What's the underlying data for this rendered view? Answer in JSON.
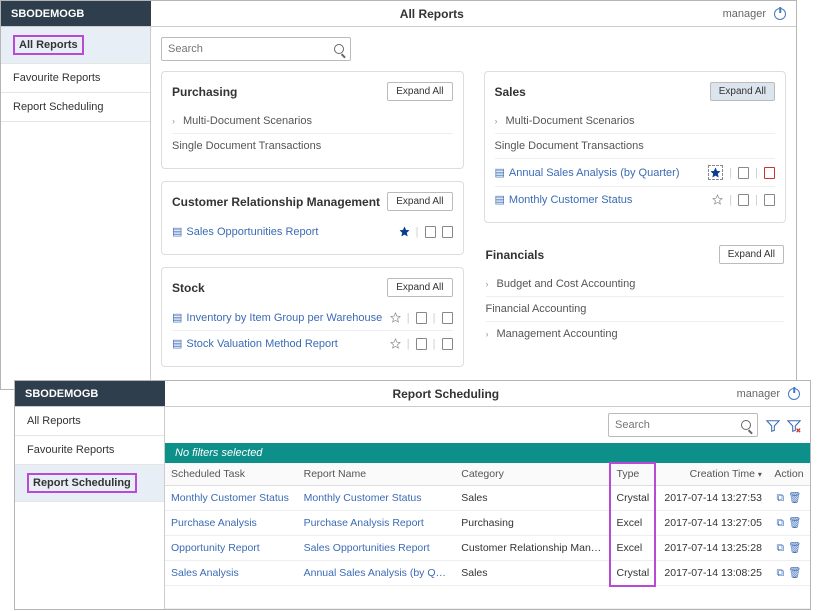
{
  "window1": {
    "brand": "SBODEMOGB",
    "title": "All Reports",
    "user": "manager",
    "sidebar": {
      "items": [
        {
          "label": "All Reports",
          "active": true,
          "highlighted": true
        },
        {
          "label": "Favourite Reports"
        },
        {
          "label": "Report Scheduling"
        }
      ]
    },
    "search": {
      "placeholder": "Search"
    },
    "left_col": [
      {
        "title": "Purchasing",
        "expand": "Expand All",
        "items": [
          {
            "label": "Multi-Document Scenarios",
            "chevron": true
          },
          {
            "label": "Single Document Transactions"
          }
        ]
      },
      {
        "title": "Customer Relationship Management",
        "expand": "Expand All",
        "items": [
          {
            "label": "Sales Opportunities Report",
            "doc": true,
            "star_filled": true,
            "actions": true
          }
        ]
      },
      {
        "title": "Stock",
        "expand": "Expand All",
        "items": [
          {
            "label": "Inventory by Item Group per Warehouse",
            "doc": true,
            "star": true,
            "actions": true
          },
          {
            "label": "Stock Valuation Method Report",
            "doc": true,
            "star": true,
            "actions": true
          }
        ]
      }
    ],
    "right_col": [
      {
        "title": "Sales",
        "expand": "Expand All",
        "expand_selected": true,
        "items": [
          {
            "label": "Multi-Document Scenarios",
            "chevron": true
          },
          {
            "label": "Single Document Transactions"
          },
          {
            "label": "Annual Sales Analysis (by Quarter)",
            "doc": true,
            "star_box_filled": true,
            "actions": true,
            "red_clip": true
          },
          {
            "label": "Monthly Customer Status",
            "doc": true,
            "star": true,
            "actions": true
          }
        ]
      },
      {
        "title": "Financials",
        "expand": "Expand All",
        "plain": true,
        "items": [
          {
            "label": "Budget and Cost Accounting",
            "chevron": true
          },
          {
            "label": "Financial Accounting"
          },
          {
            "label": "Management Accounting",
            "chevron": true
          }
        ]
      }
    ]
  },
  "window2": {
    "brand": "SBODEMOGB",
    "title": "Report Scheduling",
    "user": "manager",
    "sidebar": {
      "items": [
        {
          "label": "All Reports"
        },
        {
          "label": "Favourite Reports"
        },
        {
          "label": "Report Scheduling",
          "active": true,
          "highlighted": true
        }
      ]
    },
    "search": {
      "placeholder": "Search"
    },
    "filterbar": "No filters selected",
    "columns": {
      "task": "Scheduled Task",
      "report": "Report Name",
      "category": "Category",
      "type": "Type",
      "created": "Creation Time",
      "action": "Action"
    },
    "rows": [
      {
        "task": "Monthly Customer Status",
        "report": "Monthly Customer Status",
        "category": "Sales",
        "type": "Crystal",
        "created": "2017-07-14 13:27:53"
      },
      {
        "task": "Purchase Analysis",
        "report": "Purchase Analysis Report",
        "category": "Purchasing",
        "type": "Excel",
        "created": "2017-07-14 13:27:05"
      },
      {
        "task": "Opportunity Report",
        "report": "Sales Opportunities Report",
        "category": "Customer Relationship Man…",
        "type": "Excel",
        "created": "2017-07-14 13:25:28"
      },
      {
        "task": "Sales Analysis",
        "report": "Annual Sales Analysis (by Q…",
        "category": "Sales",
        "type": "Crystal",
        "created": "2017-07-14 13:08:25"
      }
    ]
  }
}
